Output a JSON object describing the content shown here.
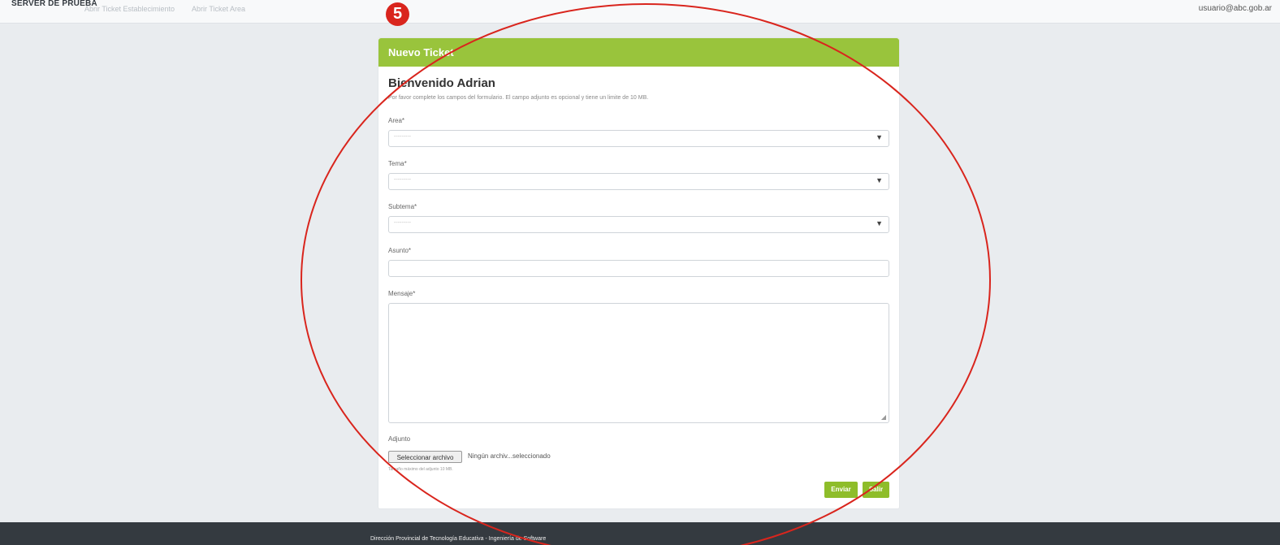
{
  "nav": {
    "brand": "SERVER DE PRUEBA",
    "links": [
      "Abrir Ticket Establecimiento",
      "Abrir Ticket Area"
    ],
    "user_email": "usuario@abc.gob.ar"
  },
  "annotation": {
    "badge_number": "5",
    "color": "#d9251d"
  },
  "card": {
    "title": "Nuevo Ticket",
    "welcome": "Bienvenido Adrian",
    "intro": "Por favor complete los campos del formulario. El campo adjunto es opcional y tiene un limite de 10 MB.",
    "fields": {
      "area": {
        "label": "Area*",
        "placeholder": "---------"
      },
      "tema": {
        "label": "Tema*",
        "placeholder": "---------"
      },
      "subtema": {
        "label": "Subtema*",
        "placeholder": "---------"
      },
      "asunto": {
        "label": "Asunto*"
      },
      "mensaje": {
        "label": "Mensaje*"
      },
      "adjunto": {
        "label": "Adjunto",
        "button": "Seleccionar archivo",
        "status": "Ningún archiv...seleccionado",
        "help": "Tamaño máximo del adjunto 10 MB."
      }
    },
    "buttons": {
      "send": "Enviar",
      "exit": "Salir"
    }
  },
  "footer": {
    "text": "Dirección Provincial de Tecnología Educativa - Ingeniería de Software"
  },
  "colors": {
    "accent": "#99c43c",
    "button": "#8ebd2a",
    "footer": "#343a40"
  }
}
